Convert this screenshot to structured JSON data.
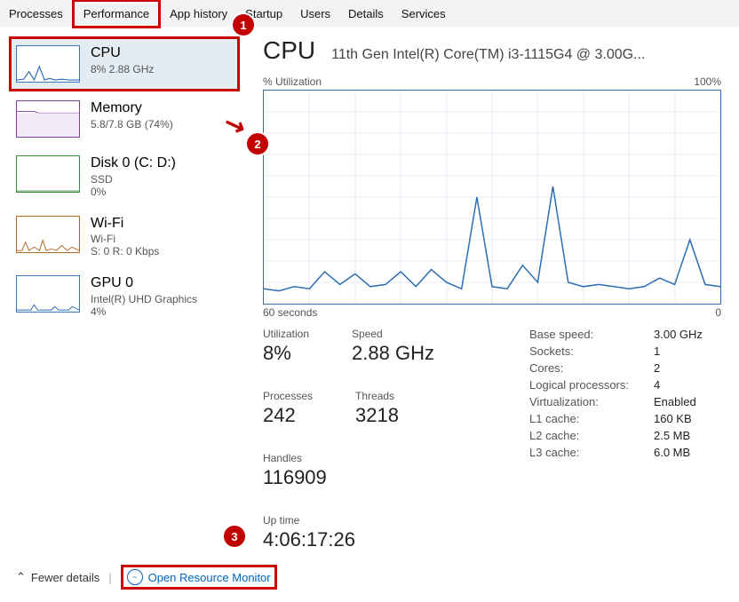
{
  "tabs": [
    "Processes",
    "Performance",
    "App history",
    "Startup",
    "Users",
    "Details",
    "Services"
  ],
  "sidebar": [
    {
      "title": "CPU",
      "line1": "8%  2.88 GHz",
      "line2": ""
    },
    {
      "title": "Memory",
      "line1": "5.8/7.8 GB (74%)",
      "line2": ""
    },
    {
      "title": "Disk 0 (C: D:)",
      "line1": "SSD",
      "line2": "0%"
    },
    {
      "title": "Wi-Fi",
      "line1": "Wi-Fi",
      "line2": "S: 0 R: 0 Kbps"
    },
    {
      "title": "GPU 0",
      "line1": "Intel(R) UHD Graphics",
      "line2": "4%"
    }
  ],
  "header": {
    "title": "CPU",
    "sub": "11th Gen Intel(R) Core(TM) i3-1115G4 @ 3.00G..."
  },
  "graph": {
    "topLeft": "% Utilization",
    "topRight": "100%",
    "bottomLeft": "60 seconds",
    "bottomRight": "0"
  },
  "stats": {
    "utilization": {
      "label": "Utilization",
      "value": "8%"
    },
    "speed": {
      "label": "Speed",
      "value": "2.88 GHz"
    },
    "processes": {
      "label": "Processes",
      "value": "242"
    },
    "threads": {
      "label": "Threads",
      "value": "3218"
    },
    "handles": {
      "label": "Handles",
      "value": "116909"
    },
    "uptime": {
      "label": "Up time",
      "value": "4:06:17:26"
    }
  },
  "specs": [
    {
      "k": "Base speed:",
      "v": "3.00 GHz"
    },
    {
      "k": "Sockets:",
      "v": "1"
    },
    {
      "k": "Cores:",
      "v": "2"
    },
    {
      "k": "Logical processors:",
      "v": "4"
    },
    {
      "k": "Virtualization:",
      "v": "Enabled"
    },
    {
      "k": "L1 cache:",
      "v": "160 KB"
    },
    {
      "k": "L2 cache:",
      "v": "2.5 MB"
    },
    {
      "k": "L3 cache:",
      "v": "6.0 MB"
    }
  ],
  "footer": {
    "fewer": "Fewer details",
    "link": "Open Resource Monitor"
  },
  "annotations": {
    "b1": "1",
    "b2": "2",
    "b3": "3"
  },
  "chart_data": {
    "type": "line",
    "title": "CPU % Utilization",
    "xlabel": "seconds",
    "ylabel": "% Utilization",
    "xlim": [
      60,
      0
    ],
    "ylim": [
      0,
      100
    ],
    "x": [
      60,
      58,
      56,
      54,
      52,
      50,
      48,
      46,
      44,
      42,
      40,
      38,
      36,
      34,
      32,
      30,
      28,
      26,
      24,
      22,
      20,
      18,
      16,
      14,
      12,
      10,
      8,
      6,
      4,
      2,
      0
    ],
    "values": [
      7,
      6,
      8,
      7,
      15,
      9,
      14,
      8,
      9,
      15,
      8,
      16,
      10,
      7,
      50,
      8,
      7,
      18,
      10,
      55,
      10,
      8,
      9,
      8,
      7,
      8,
      12,
      9,
      30,
      9,
      8
    ]
  }
}
